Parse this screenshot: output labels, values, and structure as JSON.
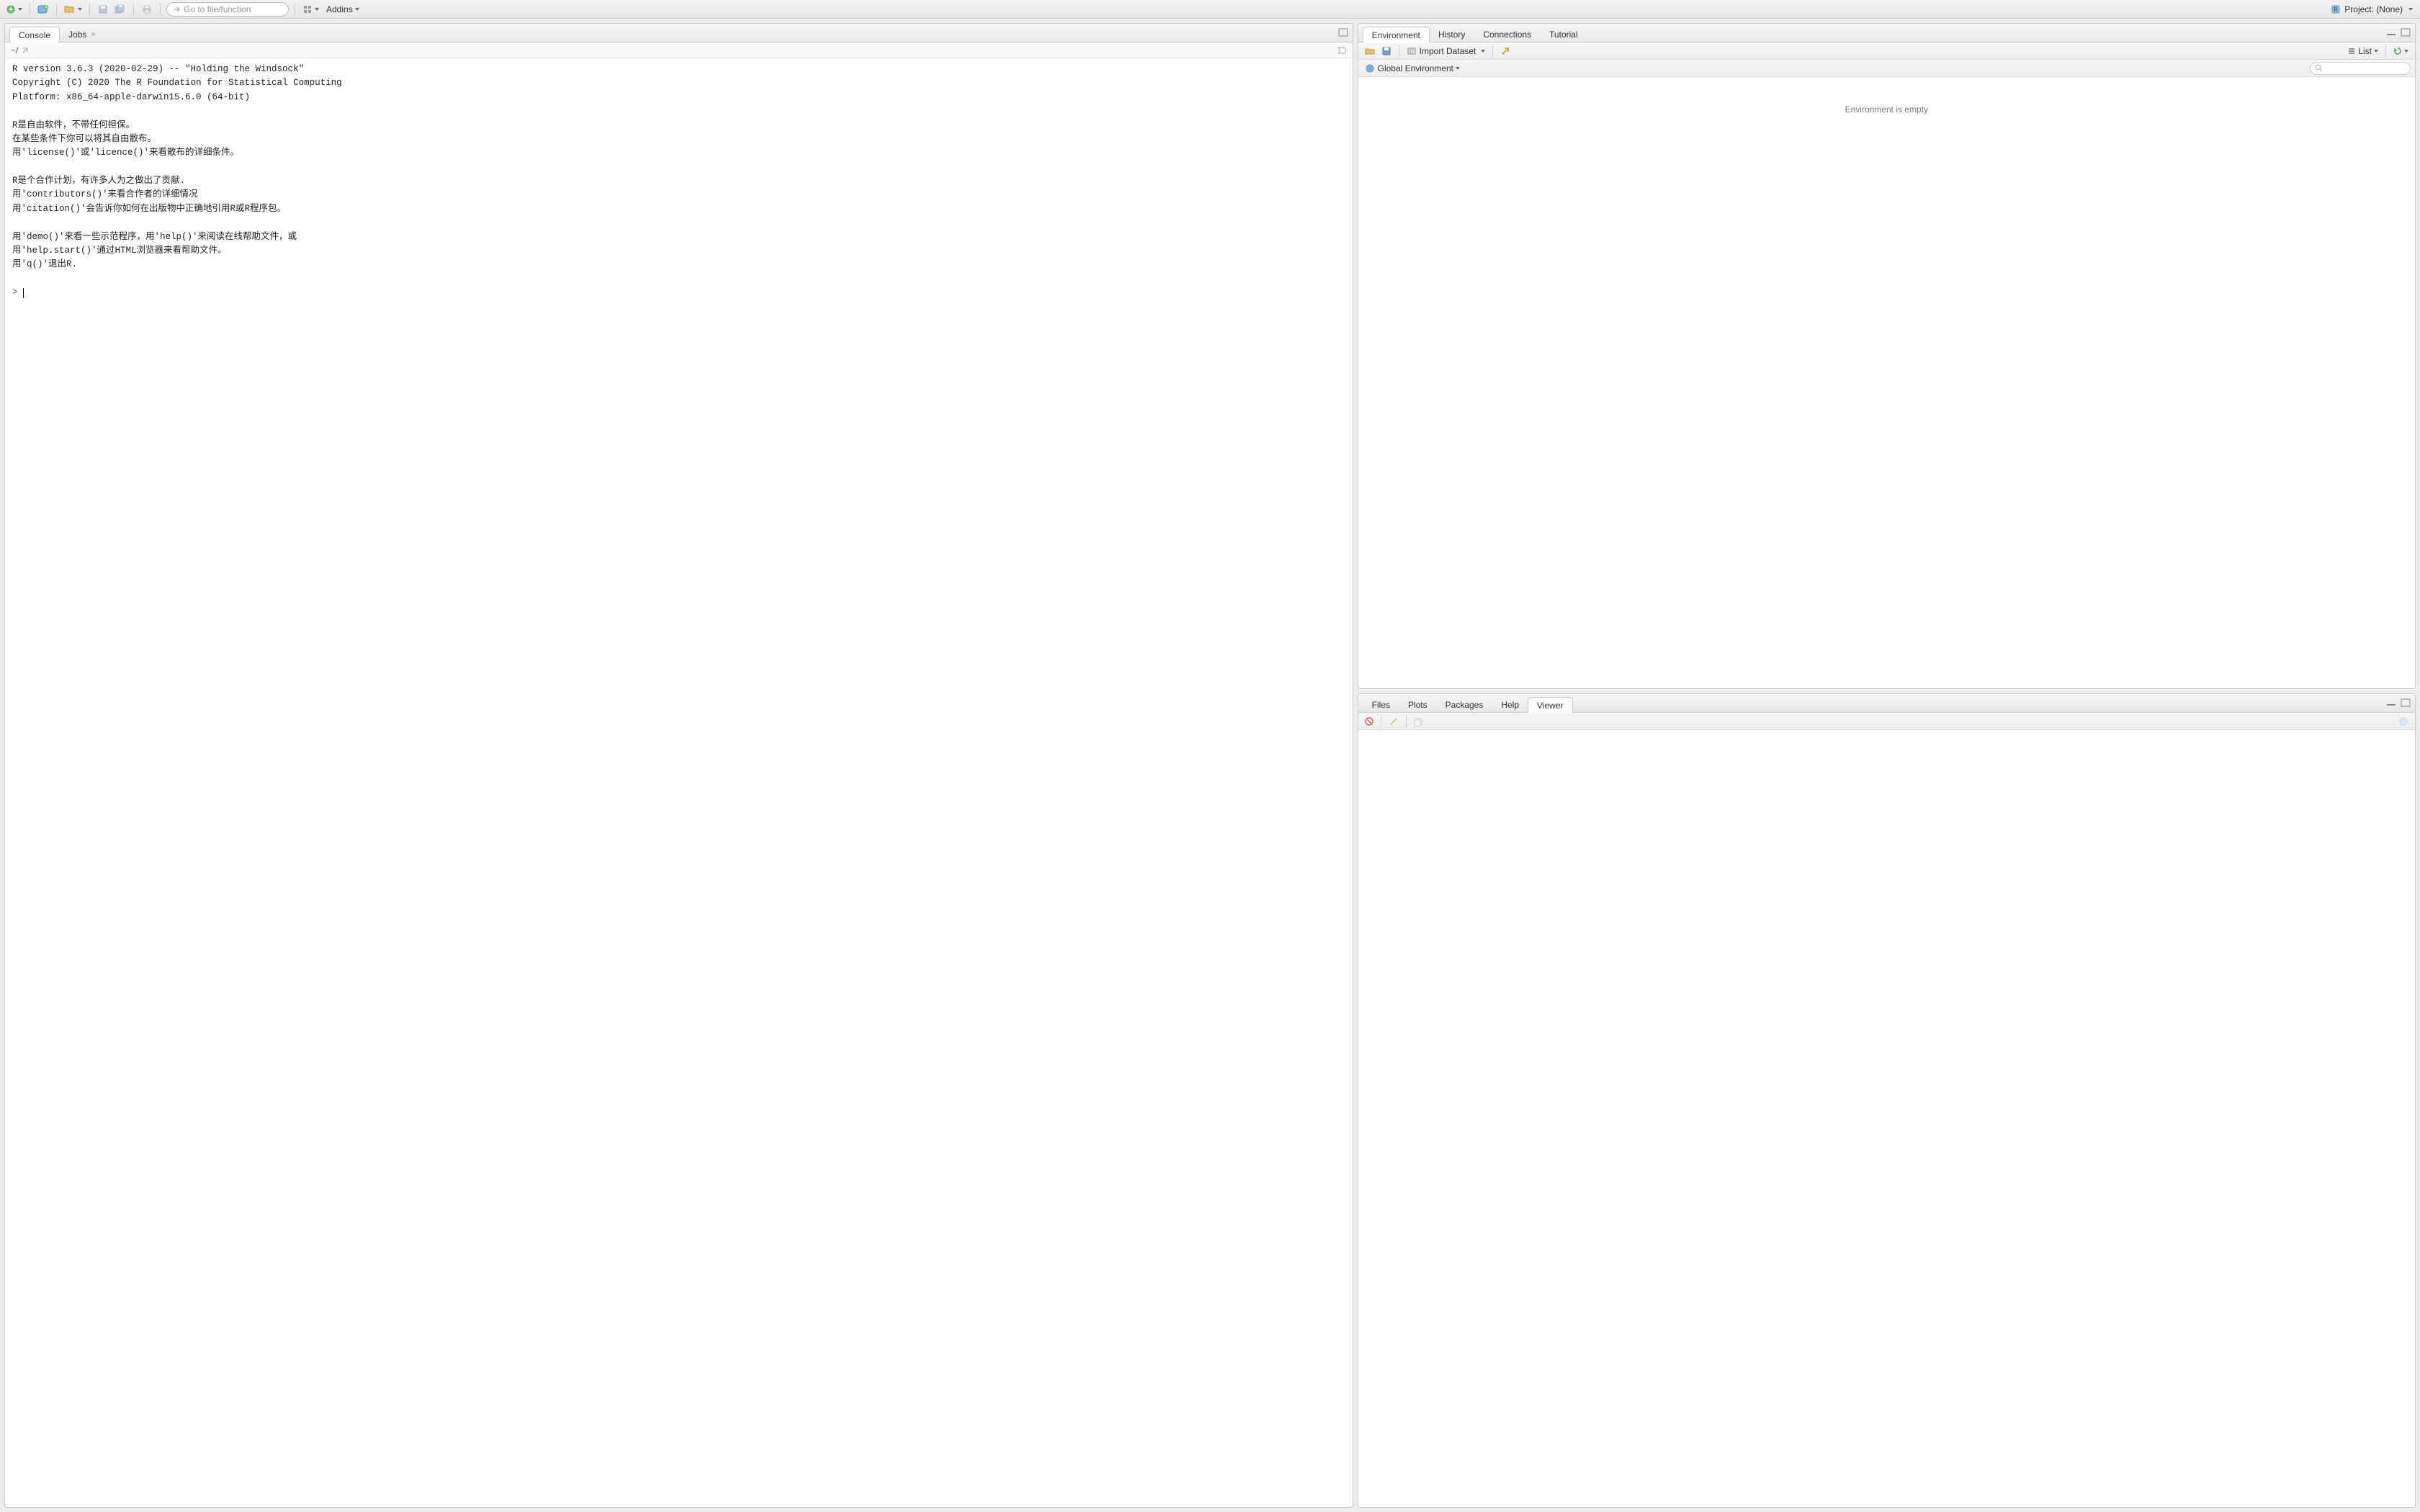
{
  "toolbar": {
    "goto_placeholder": "Go to file/function",
    "addins_label": "Addins",
    "project_label": "Project: (None)"
  },
  "left_pane": {
    "tabs": {
      "console": "Console",
      "jobs": "Jobs"
    },
    "console_path": "~/",
    "console_text": "R version 3.6.3 (2020-02-29) -- \"Holding the Windsock\"\nCopyright (C) 2020 The R Foundation for Statistical Computing\nPlatform: x86_64-apple-darwin15.6.0 (64-bit)\n\nR是自由软件，不带任何担保。\n在某些条件下你可以将其自由散布。\n用'license()'或'licence()'来看散布的详细条件。\n\nR是个合作计划，有许多人为之做出了贡献.\n用'contributors()'来看合作者的详细情况\n用'citation()'会告诉你如何在出版物中正确地引用R或R程序包。\n\n用'demo()'来看一些示范程序，用'help()'来阅读在线帮助文件，或\n用'help.start()'通过HTML浏览器来看帮助文件。\n用'q()'退出R.\n",
    "prompt": ">"
  },
  "env_pane": {
    "tabs": {
      "environment": "Environment",
      "history": "History",
      "connections": "Connections",
      "tutorial": "Tutorial"
    },
    "import_label": "Import Dataset",
    "scope_label": "Global Environment",
    "view_mode": "List",
    "empty_text": "Environment is empty"
  },
  "viewer_pane": {
    "tabs": {
      "files": "Files",
      "plots": "Plots",
      "packages": "Packages",
      "help": "Help",
      "viewer": "Viewer"
    }
  }
}
